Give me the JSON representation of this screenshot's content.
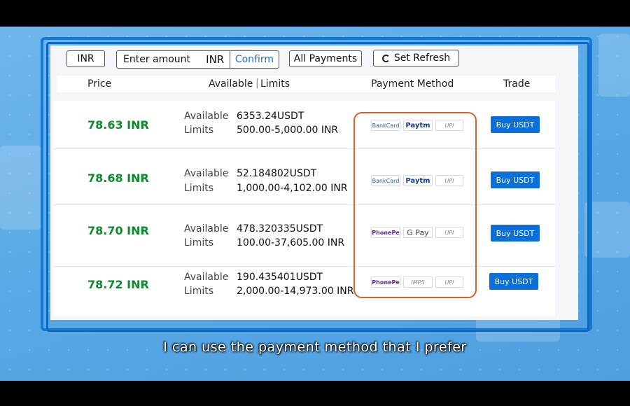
{
  "toolbar": {
    "currency_btn": "INR",
    "amount_placeholder": "Enter amount",
    "amount_currency": "INR",
    "confirm_label": "Confirm",
    "payments_label": "All Payments",
    "refresh_label": "Set Refresh"
  },
  "headers": {
    "price": "Price",
    "available": "Available",
    "limits": "Limits",
    "payment_method": "Payment Method",
    "trade": "Trade"
  },
  "rows": [
    {
      "price": "78.63 INR",
      "available_label": "Available",
      "available": "6353.24USDT",
      "limits_label": "Limits",
      "limits": "500.00-5,000.00 INR",
      "payments": [
        "BankCard",
        "Paytm",
        "UPI"
      ],
      "buy": "Buy USDT"
    },
    {
      "price": "78.68 INR",
      "available_label": "Available",
      "available": "52.184802USDT",
      "limits_label": "Limits",
      "limits": "1,000.00-4,102.00 INR",
      "payments": [
        "BankCard",
        "Paytm",
        "UPI"
      ],
      "buy": "Buy USDT"
    },
    {
      "price": "78.70 INR",
      "available_label": "Available",
      "available": "478.320335USDT",
      "limits_label": "Limits",
      "limits": "100.00-37,605.00 INR",
      "payments": [
        "PhonePe",
        "G Pay",
        "UPI"
      ],
      "buy": "Buy USDT"
    },
    {
      "price": "78.72 INR",
      "available_label": "Available",
      "available": "190.435401USDT",
      "limits_label": "Limits",
      "limits": "2,000.00-14,973.00 INR",
      "payments": [
        "PhonePe",
        "IMPS",
        "UPI"
      ],
      "buy": "Buy USDT"
    }
  ],
  "subtitle": "I can use the payment method that I prefer",
  "colors": {
    "price": "#0d8a2b",
    "buy_button": "#0a6fd8",
    "highlight": "#d5602a",
    "frame": "#1479d6"
  }
}
